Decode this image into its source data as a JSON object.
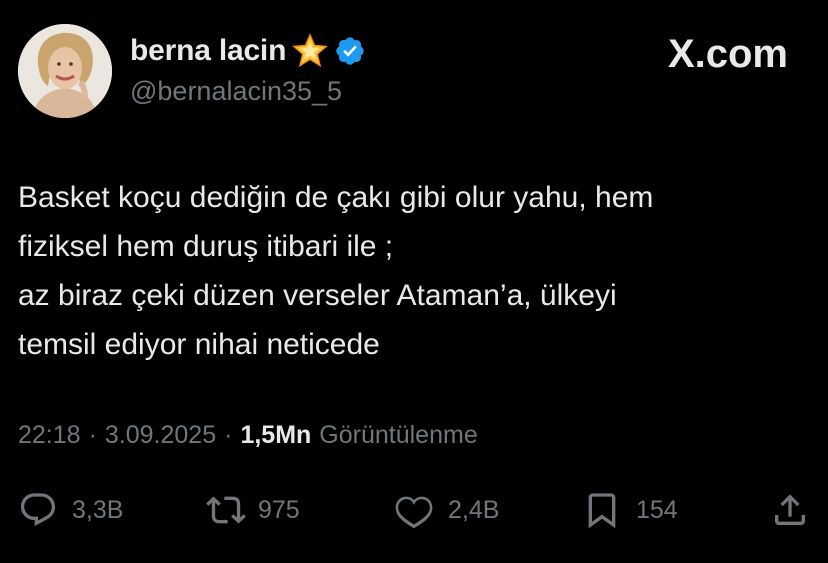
{
  "author": {
    "name": "berna lacin",
    "handle": "@bernalacin35_5",
    "badge_icon": "glowing-star-icon",
    "verified_icon": "verified-badge-icon",
    "verified_color": "#1d9bf0"
  },
  "brand": {
    "label": "X.com"
  },
  "tweet": {
    "lines": [
      "Basket koçu dediğin de çakı gibi olur yahu, hem",
      "fiziksel hem duruş itibari ile ;",
      "az biraz çeki düzen verseler Ataman’a, ülkeyi",
      "temsil ediyor nihai neticede"
    ]
  },
  "meta": {
    "time": "22:18",
    "date": "3.09.2025",
    "views_count": "1,5Mn",
    "views_label": "Görüntülenme",
    "separator": "·"
  },
  "actions": {
    "replies": "3,3B",
    "reposts": "975",
    "likes": "2,4B",
    "bookmarks": "154"
  },
  "colors": {
    "background": "#000000",
    "text": "#e7e9ea",
    "muted": "#71767b"
  }
}
